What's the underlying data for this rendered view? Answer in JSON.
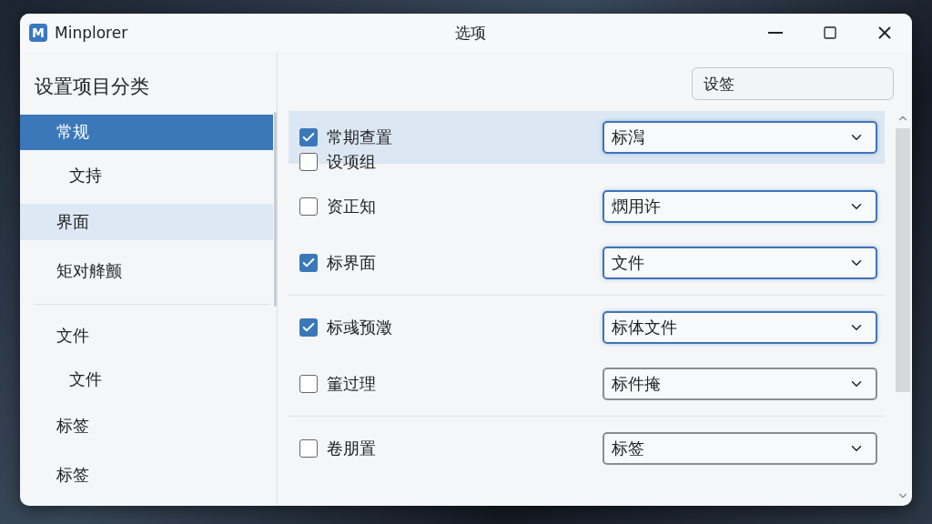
{
  "window": {
    "app_name": "Minplorer",
    "logo": "M",
    "title": "选项"
  },
  "sidebar": {
    "heading": "设置项目分类",
    "groups": [
      [
        {
          "label": "常规",
          "selected": true,
          "hovered": false,
          "children": [
            {
              "label": "文持",
              "selected": false,
              "hovered": false
            }
          ]
        },
        {
          "label": "界面",
          "selected": false,
          "hovered": true
        },
        {
          "label": "矩对舽颤",
          "selected": false,
          "hovered": false
        }
      ],
      [
        {
          "label": "文件",
          "selected": false,
          "hovered": false,
          "children": [
            {
              "label": "文件",
              "selected": false,
              "hovered": false
            }
          ]
        },
        {
          "label": "标签",
          "selected": false,
          "hovered": false
        },
        {
          "label": "标签",
          "selected": false,
          "hovered": false
        }
      ]
    ]
  },
  "search": {
    "value": "设签"
  },
  "settings": {
    "groups": [
      [
        {
          "label": "常期查置",
          "checked": true,
          "selected": true,
          "dropdown": {
            "value": "标澙",
            "focused": true
          }
        },
        {
          "label": "设项组",
          "checked": false,
          "selected": false
        },
        {
          "label": "资正知",
          "checked": false,
          "selected": false,
          "dropdown": {
            "value": "熌用许",
            "focused": true
          }
        },
        {
          "label": "标界面",
          "checked": true,
          "selected": false,
          "dropdown": {
            "value": "文件",
            "focused": true
          }
        }
      ],
      [
        {
          "label": "标彧预澂",
          "checked": true,
          "selected": false,
          "dropdown": {
            "value": "标体文件",
            "focused": true
          }
        },
        {
          "label": "箽过理",
          "checked": false,
          "selected": false,
          "dropdown": {
            "value": "标件掩",
            "focused": false
          }
        }
      ],
      [
        {
          "label": "卷朋置",
          "checked": false,
          "selected": false,
          "dropdown": {
            "value": "标签",
            "focused": false
          }
        }
      ]
    ]
  }
}
